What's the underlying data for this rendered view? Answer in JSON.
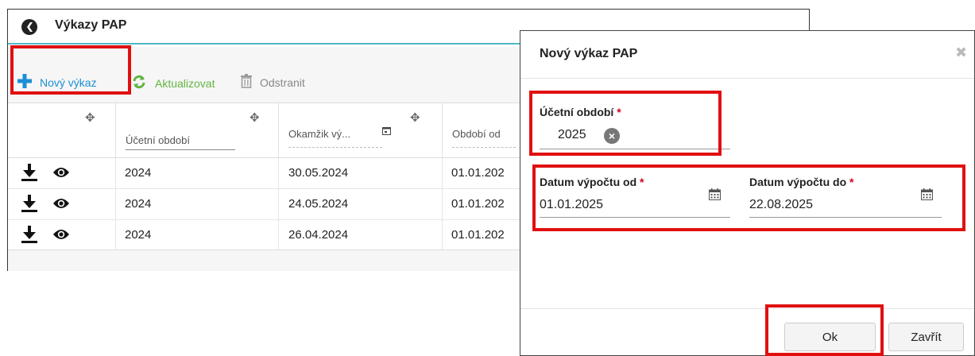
{
  "window": {
    "title": "Výkazy PAP",
    "toolbar": {
      "new_label": "Nový výkaz",
      "refresh_label": "Aktualizovat",
      "delete_label": "Odstranit"
    },
    "grid": {
      "columns": [
        "Účetní období",
        "Okamžik vý...",
        "Období od"
      ],
      "rows": [
        {
          "period": "2024",
          "moment": "30.05.2024",
          "from": "01.01.202"
        },
        {
          "period": "2024",
          "moment": "24.05.2024",
          "from": "01.01.202"
        },
        {
          "period": "2024",
          "moment": "26.04.2024",
          "from": "01.01.202"
        }
      ]
    }
  },
  "dialog": {
    "title": "Nový výkaz PAP",
    "close_icon": "close-icon",
    "fiscal_period": {
      "label": "Účetní období",
      "required_mark": "*",
      "value": "2025"
    },
    "date_from": {
      "label": "Datum výpočtu od",
      "required_mark": "*",
      "value": "01.01.2025"
    },
    "date_to": {
      "label": "Datum výpočtu do",
      "required_mark": "*",
      "value": "22.08.2025"
    },
    "ok_label": "Ok",
    "close_label": "Zavřít"
  },
  "colors": {
    "accent_blue": "#1d8fd6",
    "accent_green": "#62b540",
    "highlight_red": "#e01010",
    "title_underline": "#4fb7c6"
  }
}
